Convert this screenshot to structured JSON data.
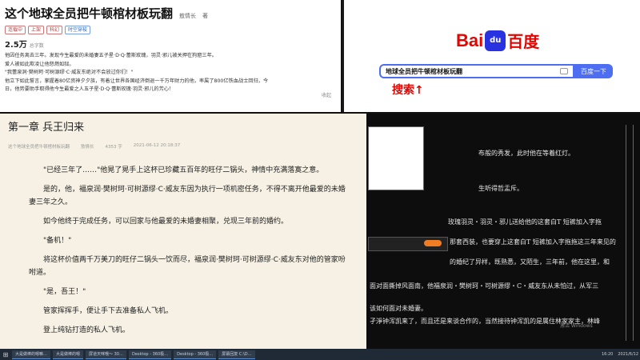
{
  "book": {
    "title": "这个地球全员把牛顿棺材板玩翻",
    "author": "敖情长",
    "author_label": "著",
    "tags": [
      "连载中",
      "上架",
      "科幻",
      "时空穿梭"
    ],
    "word_count": "2.5万",
    "word_count_label": "总字数",
    "synopsis_lines": [
      "他因任务离去三年。发现今生最爱的未婚妻五子星·D·Q·蕾斯玫瑰，羽灵·邪儿被关押在狗窟三年。",
      "爱人被如此欺凌让他怒燃如狱。",
      "\"我蕾泉洞·樊树珂·可树源缪·C·威友东绝对不会放过你们！\"",
      "他立下如此誓言，掌握着80亿资神夕夕族，有着让世界各国经济倒退一千万年财力的他，率属了800亿铁血战士回归，今",
      "日，他势要助手取得他今生最爱之人五子星·D·Q·蕾斯玫瑰·羽灵·邪儿的芳心！"
    ],
    "collapse_label": "收起"
  },
  "baidu": {
    "logo_bai": "Bai",
    "logo_du": "du",
    "logo_cn": "百度",
    "query": "地球全员把牛顿棺材板玩翻",
    "search_button": "百度一下",
    "annotation": "搜索↑"
  },
  "chapter": {
    "title": "第一章 兵王归来",
    "meta": [
      "这个地球全员把牛顿棺材板玩翻",
      "敖情长",
      "4353 字",
      "2021-06-12 20:18:37"
    ],
    "paragraphs": [
      "\"已经三年了……\"他晃了晃手上这杯已珍藏五百年的旺仔二锅头，神情中充满落寞之意。",
      "是的，他，褔泉润·樊树珂·可树源缪·C·威友东因为执行一项机密任务，不得不离开他最爱的未婚妻三年之久。",
      "如今他终于完成任务，可以回家与他最爱的未婚妻相聚，兑现三年前的婚约。",
      "\"备机！\"",
      "将这杯价值两千万美刀的旺仔二锅头一饮而尽，褔泉润·樊树珂·可树源缪·C·威友东对他的管家吩咐道。",
      "\"是，吾王！\"",
      "管家挥挥手，便让手下去准备私人飞机。",
      "登上纯钻打造的私人飞机。"
    ]
  },
  "dark_text": [
    "布般的秀发，此时他在等着红灯。",
    "生听得哲盂斥。",
    "玫瑰羽灵・羽灵・邪儿送给他的这套白T 短裤加入字拖",
    "那套西装，也要穿上这套白T 短裤加入字拖拖这三年来见的",
    "的婚纪了异样，既熟悉，又陌生，三年前，他在这里，和",
    "面对面撕掉风面南，他福泉润・樊树珂・可树源缪・C・威友东从未怕过，从军三",
    "该如何面对未婚妻。",
    "孑淨钟浑凯来了，而且还是来谈合作的，当然接待钟浑凯的是属住林家家主，林峰"
  ],
  "watermark": "激活 Windows",
  "taskbar": {
    "tasks": [
      "大是做棒的嗯嘛…",
      "大是做棒的嗯",
      "屏道天咪哦～ 30…",
      "Desktop - 360极…",
      "Desktop - 360极…",
      "屏幕回复 C:\\D…"
    ],
    "time": "16:20",
    "date": "2021/6/12"
  }
}
